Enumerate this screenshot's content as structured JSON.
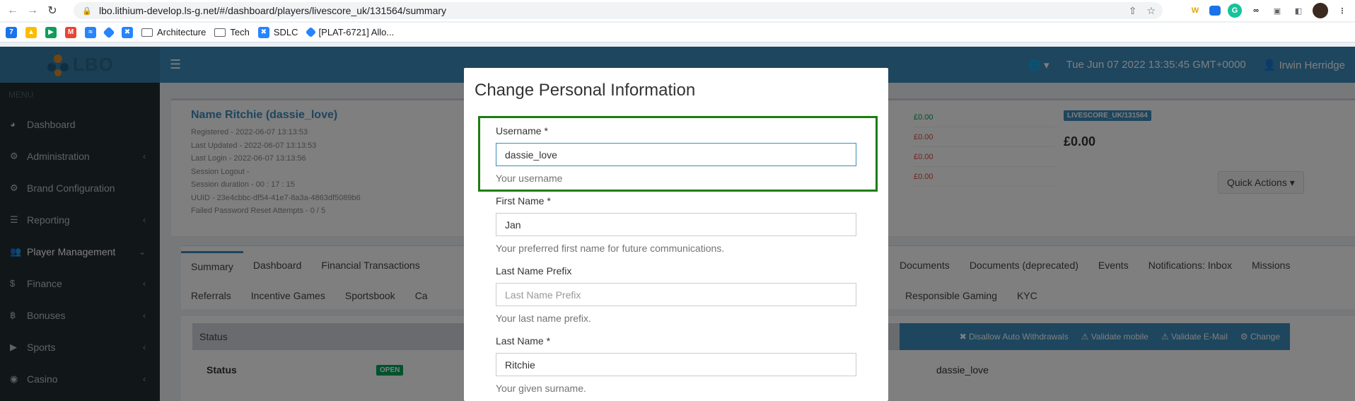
{
  "browser": {
    "url": "lbo.lithium-develop.ls-g.net/#/dashboard/players/livescore_uk/131564/summary",
    "bookmarks": [
      {
        "label": "Architecture",
        "type": "folder"
      },
      {
        "label": "Tech",
        "type": "folder"
      },
      {
        "label": "SDLC",
        "type": "link"
      },
      {
        "label": "[PLAT-6721] Allo...",
        "type": "link"
      }
    ]
  },
  "header": {
    "logo_text": "LBO",
    "datetime": "Tue Jun 07 2022 13:35:45 GMT+0000",
    "user": "Irwin Herridge"
  },
  "sidebar": {
    "menu_label": "MENU",
    "items": [
      {
        "label": "Dashboard",
        "icon": "dashboard-icon",
        "has_caret": false
      },
      {
        "label": "Administration",
        "icon": "cogs-icon",
        "has_caret": true
      },
      {
        "label": "Brand Configuration",
        "icon": "gear-icon",
        "has_caret": false
      },
      {
        "label": "Reporting",
        "icon": "list-icon",
        "has_caret": true
      },
      {
        "label": "Player Management",
        "icon": "users-icon",
        "has_caret": true
      },
      {
        "label": "Finance",
        "icon": "dollar-icon",
        "has_caret": true
      },
      {
        "label": "Bonuses",
        "icon": "bitcoin-icon",
        "has_caret": true
      },
      {
        "label": "Sports",
        "icon": "play-circle-icon",
        "has_caret": true
      },
      {
        "label": "Casino",
        "icon": "gamepad-icon",
        "has_caret": true
      }
    ]
  },
  "profile": {
    "name": "Name Ritchie (dassie_love)",
    "registered": "Registered - 2022-06-07 13:13:53",
    "last_updated": "Last Updated - 2022-06-07 13:13:53",
    "last_login": "Last Login - 2022-06-07 13:13:56",
    "session_logout": "Session Logout -",
    "session_duration": "Session duration - 00 : 17 : 15",
    "uuid": "UUID - 23e4cbbc-df54-41e7-8a3a-4863df5089b6",
    "failed_reset": "Failed Password Reset Attempts - 0 / 5",
    "balances": [
      "£0.00",
      "£0.00",
      "£0.00",
      "£0.00"
    ],
    "brand_label": "LIVESCORE_UK/131564",
    "big_balance": "£0.00",
    "quick_actions": "Quick Actions"
  },
  "tabs": {
    "row1": [
      "Summary",
      "Dashboard",
      "Financial Transactions",
      "Documents",
      "Documents (deprecated)",
      "Events",
      "Notifications: Inbox",
      "Missions"
    ],
    "row2": [
      "Referrals",
      "Incentive Games",
      "Sportsbook",
      "Ca",
      "Responsible Gaming",
      "KYC"
    ]
  },
  "status": {
    "header": "Status",
    "actions": [
      "Disallow Auto Withdrawals",
      "Validate mobile",
      "Validate E-Mail",
      "Change"
    ],
    "row_label": "Status",
    "badge": "OPEN",
    "username": "dassie_love"
  },
  "modal": {
    "title": "Change Personal Information",
    "fields": [
      {
        "label": "Username *",
        "value": "dassie_love",
        "placeholder": "",
        "help": "Your username"
      },
      {
        "label": "First Name *",
        "value": "Jan",
        "placeholder": "",
        "help": "Your preferred first name for future communications."
      },
      {
        "label": "Last Name Prefix",
        "value": "",
        "placeholder": "Last Name Prefix",
        "help": "Your last name prefix."
      },
      {
        "label": "Last Name *",
        "value": "Ritchie",
        "placeholder": "",
        "help": "Your given surname."
      }
    ]
  }
}
